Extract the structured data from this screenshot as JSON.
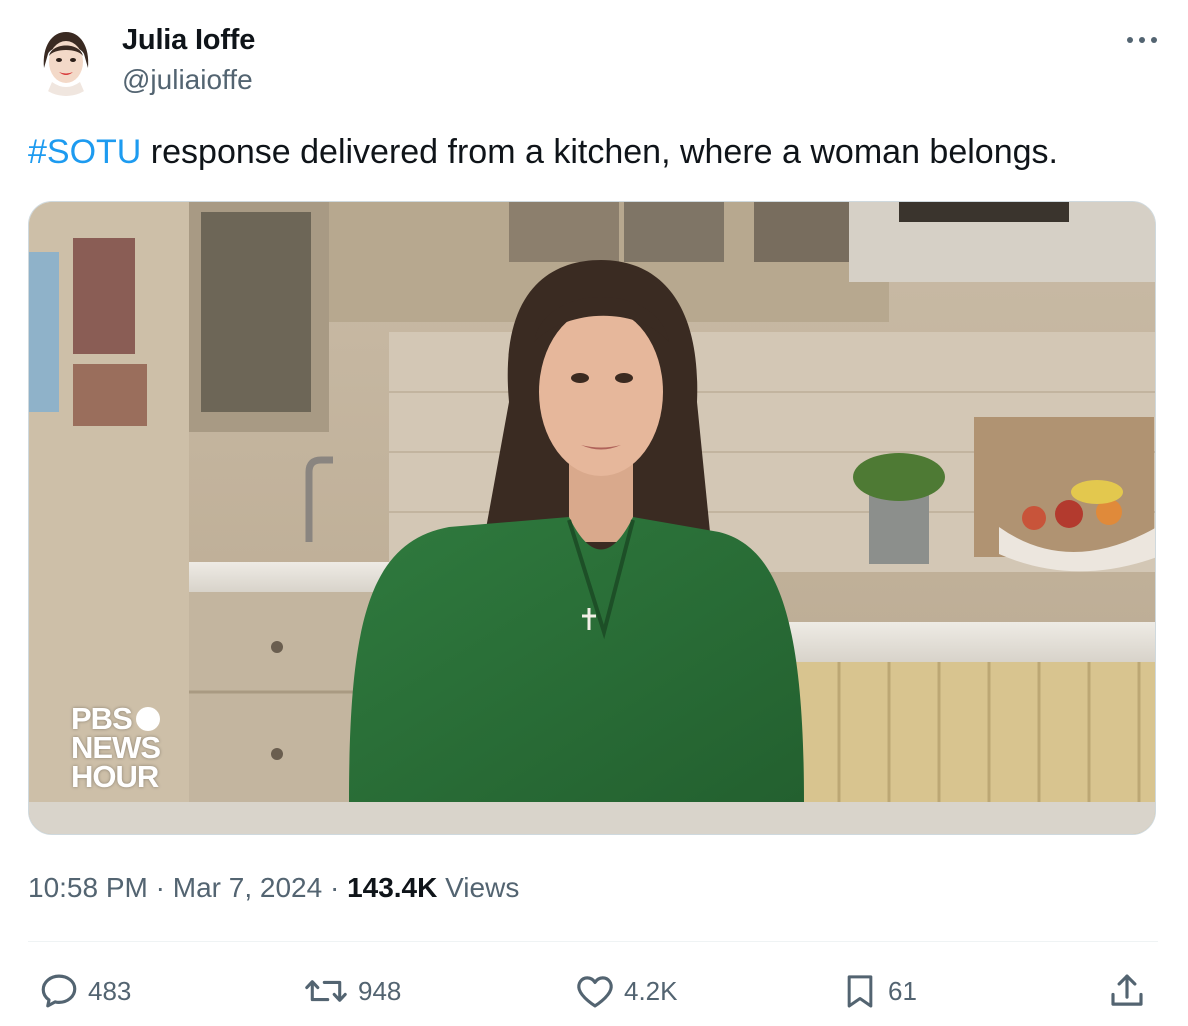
{
  "author": {
    "display_name": "Julia Ioffe",
    "handle": "@juliaioffe",
    "avatar_icon": "cartoon-portrait-avatar"
  },
  "tweet": {
    "hashtag": "#SOTU",
    "text": " response delivered from a kitchen, where a woman belongs."
  },
  "media": {
    "watermark": {
      "line1": "PBS",
      "line2": "NEWS",
      "line3": "HOUR"
    }
  },
  "meta": {
    "time": "10:58 PM",
    "separator": "·",
    "date": "Mar 7, 2024",
    "views_count": "143.4K",
    "views_label": "Views"
  },
  "actions": {
    "replies": "483",
    "reposts": "948",
    "likes": "4.2K",
    "bookmarks": "61"
  },
  "colors": {
    "link": "#1d9bf0",
    "secondary_text": "#536471",
    "primary_text": "#0f1419"
  }
}
